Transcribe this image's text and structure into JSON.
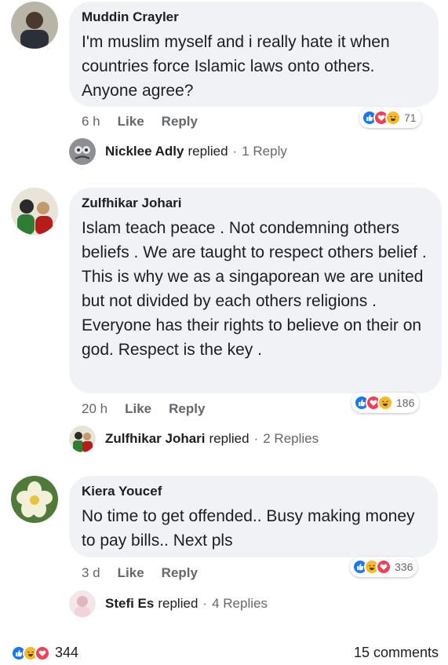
{
  "comments": [
    {
      "author": "Muddin Crayler",
      "text": "I'm muslim myself and i really hate it when countries force Islamic laws onto others. Anyone agree?",
      "time": "6 h",
      "like_label": "Like",
      "reply_label": "Reply",
      "reaction_count": "71",
      "reactions": [
        "like-icon",
        "love-icon",
        "haha-icon"
      ],
      "reply_summary": {
        "name": "Nicklee Adly",
        "verb": "replied",
        "separator": "·",
        "count": "1 Reply"
      }
    },
    {
      "author": "Zulfhikar Johari",
      "text": "Islam teach peace . Not condemning others beliefs . We are taught to respect others belief . This is why we as a singaporean we are united but not divided by each others religions . Everyone has their rights to believe on their on god. Respect is the key .",
      "time": "20 h",
      "like_label": "Like",
      "reply_label": "Reply",
      "reaction_count": "186",
      "reactions": [
        "like-icon",
        "love-icon",
        "haha-icon"
      ],
      "reply_summary": {
        "name": "Zulfhikar Johari",
        "verb": "replied",
        "separator": "·",
        "count": "2 Replies"
      }
    },
    {
      "author": "Kiera Youcef",
      "text": "No time to get offended.. Busy making money to pay bills.. Next pls",
      "time": "3 d",
      "like_label": "Like",
      "reply_label": "Reply",
      "reaction_count": "336",
      "reactions": [
        "like-icon",
        "haha-icon",
        "love-icon"
      ],
      "reply_summary": {
        "name": "Stefi Es",
        "verb": "replied",
        "separator": "·",
        "count": "4 Replies"
      }
    }
  ],
  "footer": {
    "reactions": [
      "like-icon",
      "haha-icon",
      "love-icon"
    ],
    "total_reactions": "344",
    "comments_label": "15 comments"
  },
  "colors": {
    "like": "#1877f2",
    "love": "#f33e58",
    "haha": "#f7b928",
    "bubble": "#f0f2f5",
    "meta": "#65676b"
  }
}
